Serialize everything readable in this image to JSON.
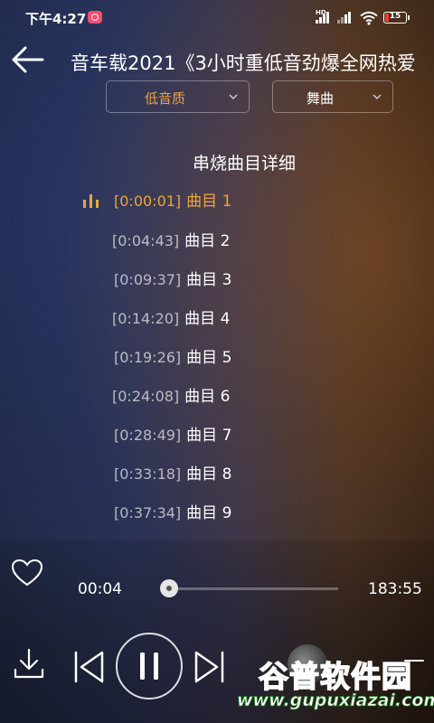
{
  "status_bar": {
    "time": "下午4:27",
    "hd_label": "HD",
    "battery_level": "15",
    "battery_color": "#ff3b30"
  },
  "header": {
    "title": "音车载2021《3小时重低音劲爆全网热爱"
  },
  "filters": {
    "quality": {
      "value": "低音质",
      "color": "#f0a33c"
    },
    "genre": {
      "value": "舞曲"
    }
  },
  "tracklist": {
    "heading": "串烧曲目详细",
    "accent_color": "#f0a33c",
    "active_index": 0,
    "tracks": [
      {
        "time": "[0:00:01]",
        "name": "曲目 1"
      },
      {
        "time": "[0:04:43]",
        "name": "曲目 2"
      },
      {
        "time": "[0:09:37]",
        "name": "曲目 3"
      },
      {
        "time": "[0:14:20]",
        "name": "曲目 4"
      },
      {
        "time": "[0:19:26]",
        "name": "曲目 5"
      },
      {
        "time": "[0:24:08]",
        "name": "曲目 6"
      },
      {
        "time": "[0:28:49]",
        "name": "曲目 7"
      },
      {
        "time": "[0:33:18]",
        "name": "曲目 8"
      },
      {
        "time": "[0:37:34]",
        "name": "曲目 9"
      }
    ]
  },
  "player": {
    "elapsed": "00:04",
    "total": "183:55",
    "progress_fraction": 0.0004,
    "state": "playing"
  },
  "icons": {
    "back": "arrow-left-icon",
    "like": "heart-outline-icon",
    "download": "download-icon",
    "prev": "skip-previous-icon",
    "pause": "pause-icon",
    "next": "skip-next-icon",
    "menu": "menu-icon",
    "dropdown": "chevron-down-icon",
    "playing": "equalizer-bars-icon"
  },
  "watermark": {
    "name": "谷普软件园",
    "url": "www.gupuxiazai.com"
  }
}
